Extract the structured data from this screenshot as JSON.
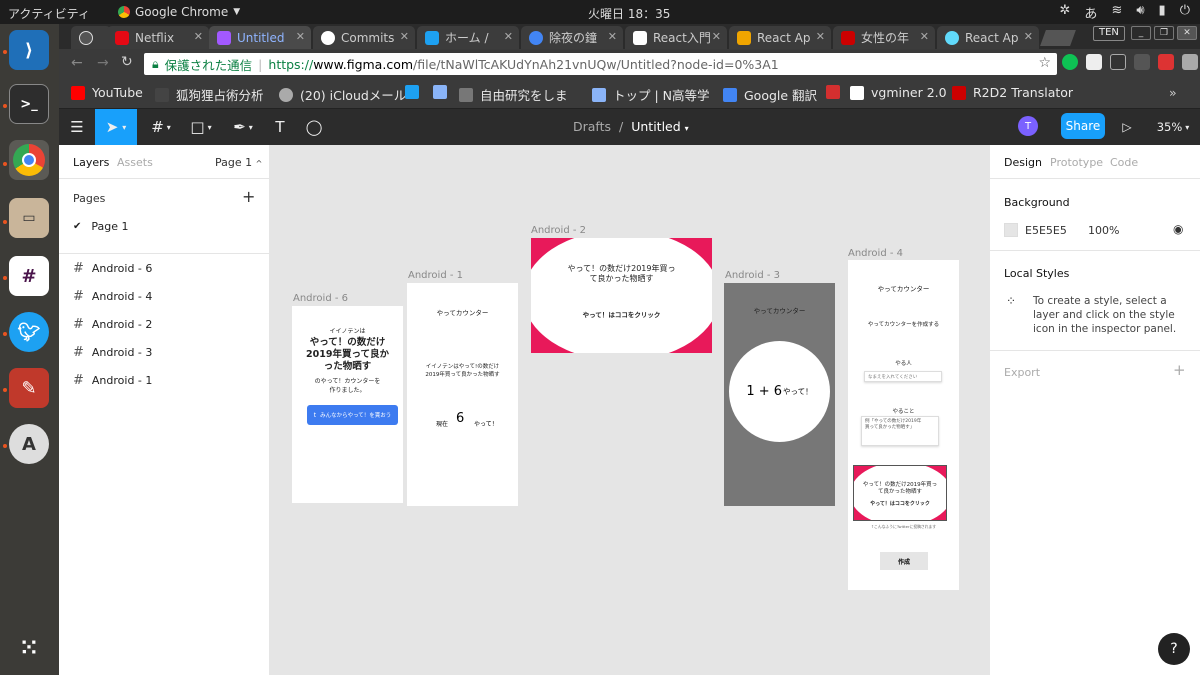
{
  "topbar": {
    "activities": "アクティビティ",
    "app_name": "Google Chrome",
    "clock": "火曜日 18：35",
    "ime": "あ"
  },
  "tabs": [
    {
      "label": "",
      "color": "#555555"
    },
    {
      "label": "Netflix",
      "color": "#e50914"
    },
    {
      "label": "Untitled",
      "color": "#a259ff"
    },
    {
      "label": "Commits",
      "color": "#ffffff"
    },
    {
      "label": "ホーム /",
      "color": "#1da1f2"
    },
    {
      "label": "除夜の鐘",
      "color": "#4285f4"
    },
    {
      "label": "React入門",
      "color": "#ffffff"
    },
    {
      "label": "React Ap",
      "color": "#f0a500"
    },
    {
      "label": "女性の年",
      "color": "#cc0000"
    },
    {
      "label": "React Ap",
      "color": "#61dafb"
    }
  ],
  "window": {
    "profile": "TEN"
  },
  "address": {
    "secure": "保護された通信",
    "scheme": "https://",
    "host": "www.figma.com",
    "path": "/file/tNaWlTcAKUdYnAh21vnUQw/Untitled?node-id=0%3A1"
  },
  "bookmarks": [
    {
      "label": "YouTube",
      "color": "#ff0000"
    },
    {
      "label": "狐狗狸占術分析",
      "color": "#444444"
    },
    {
      "label": "(20) iCloudメール",
      "color": "#aaaaaa"
    },
    {
      "label": "",
      "color": "#1da1f2"
    },
    {
      "label": "",
      "color": "#8ab4f8"
    },
    {
      "label": "自由研究をしま",
      "color": "#777777"
    },
    {
      "label": "トップ | N高等学",
      "color": "#8ab4f8"
    },
    {
      "label": "Google 翻訳",
      "color": "#4285f4"
    },
    {
      "label": "",
      "color": "#d32f2f"
    },
    {
      "label": "vgminer 2.0",
      "color": "#ffffff"
    },
    {
      "label": "R2D2 Translator",
      "color": "#cc0000"
    }
  ],
  "figma": {
    "breadcrumb_drafts": "Drafts",
    "breadcrumb_sep": "/",
    "file_name": "Untitled",
    "share": "Share",
    "zoom": "35%",
    "avatar": "T"
  },
  "left_panel": {
    "tab_layers": "Layers",
    "tab_assets": "Assets",
    "page_select": "Page 1",
    "pages_header": "Pages",
    "pages": [
      "Page 1"
    ],
    "layers": [
      "Android - 6",
      "Android - 4",
      "Android - 2",
      "Android - 3",
      "Android - 1"
    ]
  },
  "right_panel": {
    "tab_design": "Design",
    "tab_prototype": "Prototype",
    "tab_code": "Code",
    "background_header": "Background",
    "bg_hex": "E5E5E5",
    "bg_opacity": "100%",
    "local_styles_header": "Local Styles",
    "local_styles_hint": "To create a style, select a layer and click on the style icon in the inspector panel.",
    "export_header": "Export"
  },
  "frames": {
    "android6": {
      "label": "Android - 6",
      "small": "イイノテンは",
      "headline": "やって！の数だけ2019年買って良かった物晒す",
      "sub1": "のやって！カウンターを",
      "sub2": "作りました。",
      "button": "みんなからやって！を貰おう"
    },
    "android1": {
      "label": "Android - 1",
      "title": "やってカウンター",
      "body1": "イイノテンはやって!の数だけ",
      "body2": "2019年買って良かった物晒す",
      "now": "現在",
      "count": "6",
      "unit": "やって！"
    },
    "android2": {
      "label": "Android - 2",
      "line1": "やって！の数だけ2019年買っ",
      "line2": "て良かった物晒す",
      "cta": "やって！はココをクリック"
    },
    "android3": {
      "label": "Android - 3",
      "title": "やってカウンター",
      "expr": "1 + 6",
      "unit": "やって！"
    },
    "android4": {
      "label": "Android - 4",
      "title": "やってカウンター",
      "subtitle": "やってカウンターを作成する",
      "name_label": "やる人",
      "name_placeholder": "なまえを入れてください",
      "todo_label": "やること",
      "todo_line1": "例「やっての数だけ2019年",
      "todo_line2": "買って良かった物晒す」",
      "card_line1": "やって！の数だけ2019年買っ",
      "card_line2": "て良かった物晒す",
      "card_cta": "やって！はココをクリック",
      "note": "↑こんなふうにTwitterに投稿されます",
      "create": "作成"
    }
  },
  "colors": {
    "accent": "#18a0fb",
    "pink": "#e8195a",
    "canvas": "#e5e5e5",
    "gray_frame": "#777777",
    "button_blue": "#3d7bf0"
  },
  "help": "?"
}
